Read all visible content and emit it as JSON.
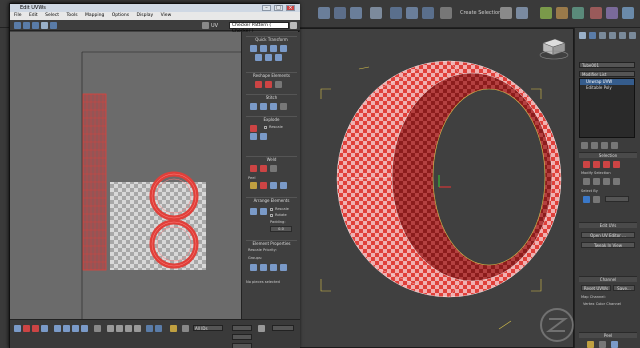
{
  "uvw_window": {
    "title": "Edit UVWs",
    "menu": [
      "File",
      "Edit",
      "Select",
      "Tools",
      "Mapping",
      "Options",
      "Display",
      "View"
    ],
    "uv_label": "UV",
    "pattern_select": "Checker Pattern  ( Checker )",
    "rollouts": {
      "quick_transform": "Quick Transform",
      "reshape_elements": "Reshape Elements",
      "stitch": "Stitch",
      "explode": "Explode",
      "weld": "Weld",
      "peel": "Peel",
      "arrange_elements": "Arrange Elements",
      "rescale": "Rescale",
      "rotate": "Rotate",
      "padding_label": "Padding:",
      "padding_value": "0.0",
      "element_properties": "Element Properties",
      "rescale_priority": "Rescale Priority:",
      "groups": "Groups:"
    },
    "status": "No pieces selected",
    "zoom_value": "All IDs"
  },
  "command_panel": {
    "object_name": "Tube001",
    "modifier_list": "Modifier List",
    "stack": [
      "Unwrap UVW",
      "Editable Poly"
    ],
    "selection_title": "Selection",
    "modify_selection": "Modify Selection",
    "select_by": "Select By",
    "edit_uvs": "Edit UVs",
    "open_uv_editor": "Open UV Editor ...",
    "tweak_in_view": "Tweak In View",
    "channel_title": "Channel",
    "reset_uvws": "Reset UVWs",
    "save": "Save...",
    "map_channel": "Map Channel:",
    "vertex_color_channel": "Vertex Color Channel",
    "peel_title": "Peel"
  },
  "main_toolbar": {
    "selection_set": "Create Selection Se"
  },
  "colors": {
    "uv_red": "#e0403a",
    "checker_light": "#d8d8d8",
    "checker_dark": "#a8a8a8",
    "viewport_bg": "#404040",
    "gizmo_yellow": "#d8c24a",
    "selection_blue": "#355c8c"
  }
}
